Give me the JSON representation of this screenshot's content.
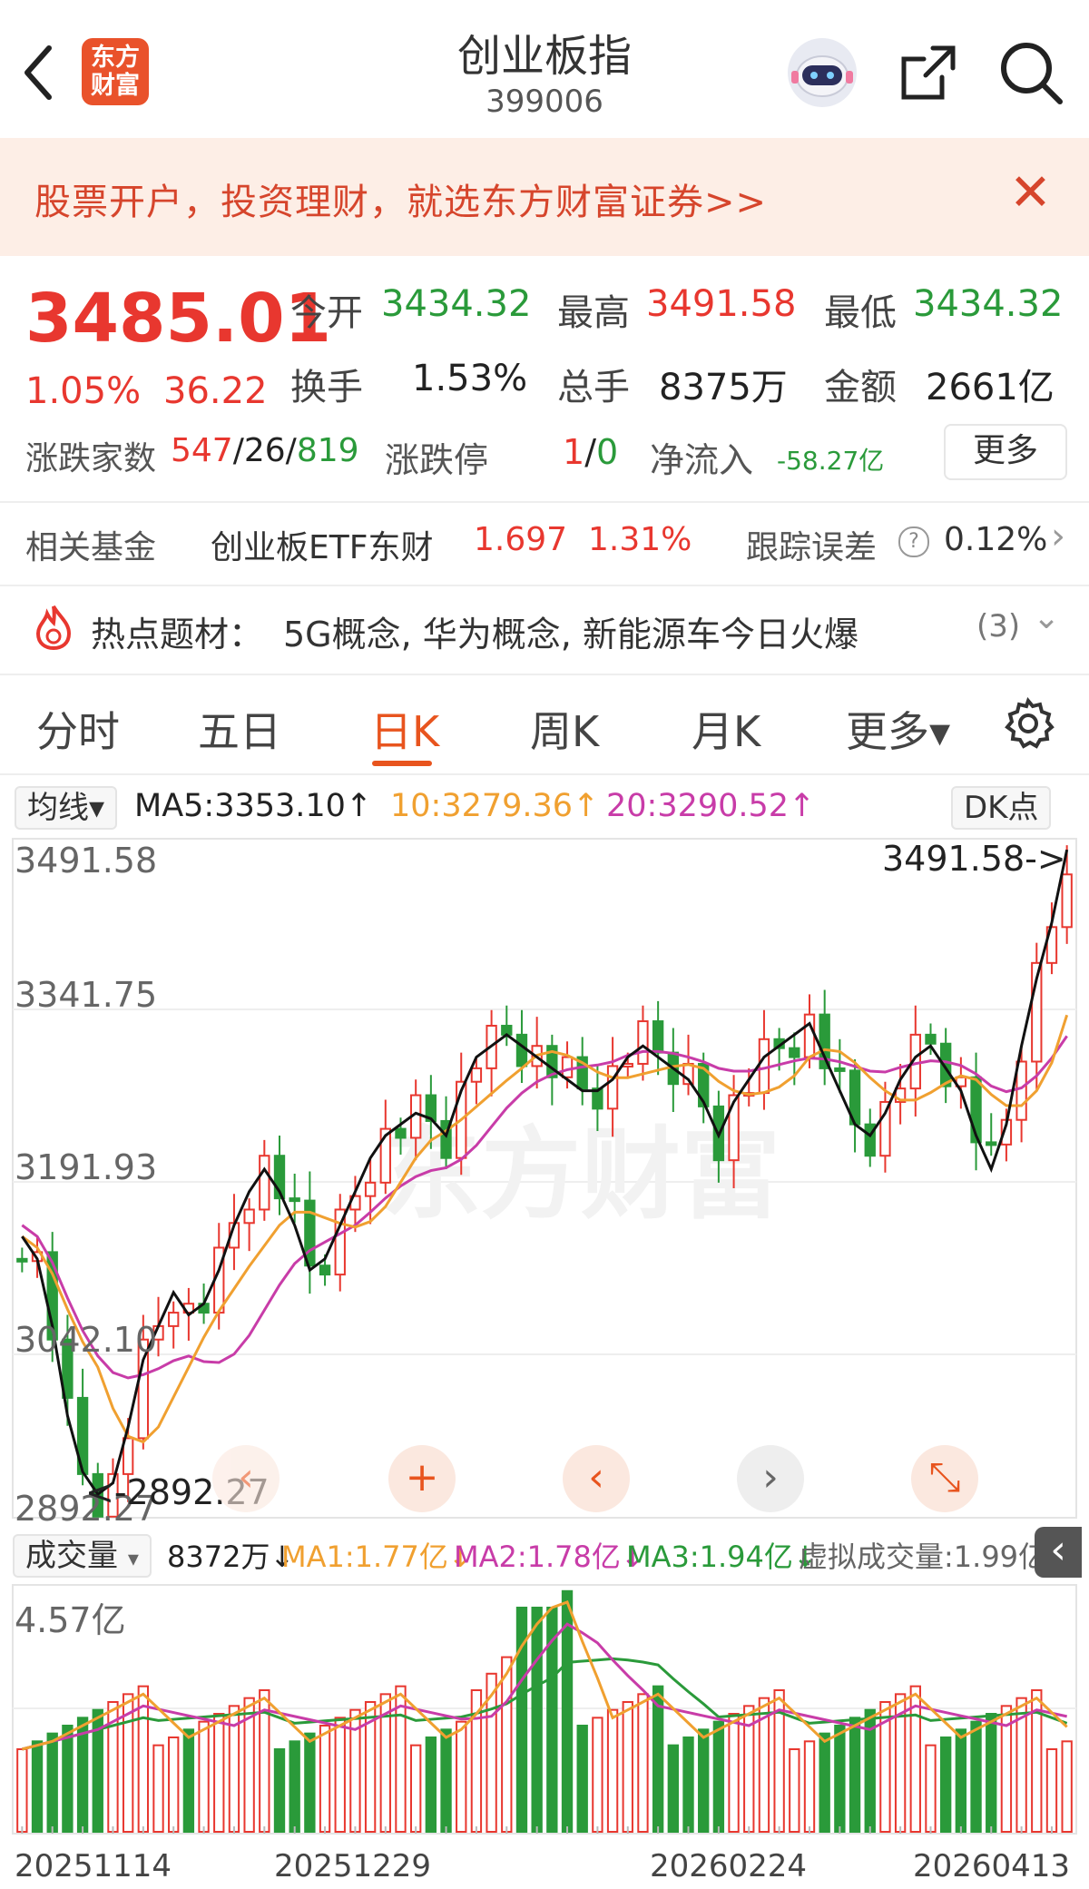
{
  "header": {
    "title": "创业板指",
    "code": "399006",
    "logo_text_1": "东方",
    "logo_text_2": "财富",
    "icons": [
      "back-arrow-icon",
      "robot-avatar-icon",
      "share-icon",
      "search-icon"
    ]
  },
  "banner": {
    "text": "股票开户，投资理财，就选东方财富证券>>",
    "close": "✕"
  },
  "quote": {
    "price": "3485.01",
    "change_pct": "1.05%",
    "change": "36.22",
    "open_label": "今开",
    "open": "3434.32",
    "high_label": "最高",
    "high": "3491.58",
    "low_label": "最低",
    "low": "3434.32",
    "turnover_label": "换手",
    "turnover": "1.53%",
    "volume_label": "总手",
    "volume": "8375万",
    "amount_label": "金额",
    "amount": "2661亿",
    "breadth_label": "涨跌家数",
    "up": "547",
    "sep1": "/",
    "flat": "26",
    "sep2": "/",
    "down": "819",
    "limit_label": "涨跌停",
    "limit_up": "1",
    "limit_sep": "/",
    "limit_down": "0",
    "inflow_label": "净流入",
    "inflow": "-58.27亿",
    "more": "更多"
  },
  "fund": {
    "label": "相关基金",
    "name": "创业板ETF东财",
    "price": "1.697",
    "pct": "1.31%",
    "error_label": "跟踪误差",
    "error": "0.12%",
    "help": "?",
    "arrow": "›"
  },
  "hot": {
    "label": "热点题材：",
    "topics": "5G概念, 华为概念, 新能源车今日火爆",
    "count": "(3)",
    "chevron": "⌄"
  },
  "tabs": [
    "分时",
    "五日",
    "日K",
    "周K",
    "月K",
    "更多▾"
  ],
  "active_tab": 2,
  "ma_bar": {
    "select": "均线▾",
    "ma5": "MA5:3353.10↑",
    "ma10": "10:3279.36↑",
    "ma20": "20:3290.52↑",
    "dk": "DK点"
  },
  "price_axis": [
    "3491.58",
    "3341.75",
    "3191.93",
    "3042.10",
    "2892.27"
  ],
  "annotations": {
    "high": "3491.58->",
    "low": "<-2892.27"
  },
  "watermark": "东方财富",
  "controls": [
    "‹",
    "+",
    "‹",
    "›",
    "⤡"
  ],
  "vol_bar": {
    "select": "成交量",
    "caret": "▾",
    "vol": "8372万↓",
    "ma1": "MA1:1.77亿↓",
    "ma2": "MA2:1.78亿↓",
    "ma3": "MA3:1.94亿↓",
    "virtual": "虚拟成交量:1.99亿",
    "collapse": "‹"
  },
  "vol_axis_max": "4.57亿",
  "dates": [
    "20251114",
    "20251229",
    "20260224",
    "20260413"
  ],
  "colors": {
    "up": "#e8372f",
    "down": "#2a9a3a",
    "accent": "#e8541e",
    "ma5": "#111111",
    "ma10": "#f0a030",
    "ma20": "#c83ca8"
  },
  "chart_data": {
    "type": "candlestick",
    "ylim": [
      2892.27,
      3491.58
    ],
    "ma5_close_approx": [
      3140,
      3120,
      3060,
      2980,
      2930,
      2910,
      2920,
      2970,
      3030,
      3060,
      3090,
      3070,
      3080,
      3110,
      3150,
      3180,
      3200,
      3180,
      3150,
      3110,
      3120,
      3150,
      3180,
      3210,
      3230,
      3240,
      3250,
      3245,
      3230,
      3270,
      3300,
      3310,
      3320,
      3310,
      3300,
      3290,
      3280,
      3270,
      3270,
      3280,
      3300,
      3310,
      3300,
      3290,
      3280,
      3260,
      3230,
      3260,
      3280,
      3300,
      3310,
      3320,
      3330,
      3300,
      3270,
      3240,
      3230,
      3250,
      3280,
      3300,
      3310,
      3290,
      3270,
      3230,
      3200,
      3240,
      3310,
      3370,
      3420,
      3485
    ],
    "volume_max": "4.57亿"
  }
}
